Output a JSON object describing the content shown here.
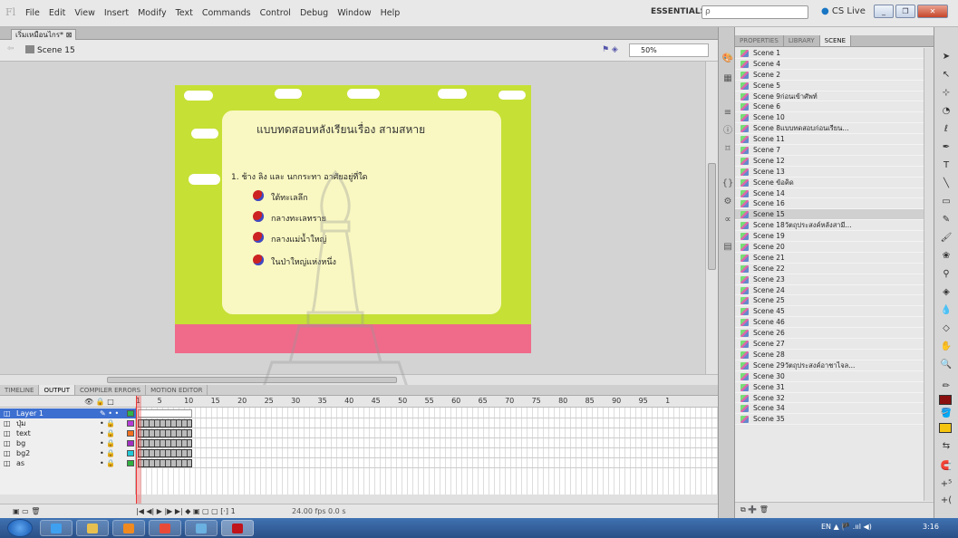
{
  "app": {
    "logo": "Fl",
    "menus": [
      "File",
      "Edit",
      "View",
      "Insert",
      "Modify",
      "Text",
      "Commands",
      "Control",
      "Debug",
      "Window",
      "Help"
    ],
    "workspace": "ESSENTIALS ▾",
    "search_placeholder": "ρ",
    "cs_live": "CS Live"
  },
  "document": {
    "tab_label": "เริ่มเหมือนไกร* ⊠",
    "scene_crumb": "Scene 15",
    "zoom": "50%"
  },
  "stage": {
    "title": "แบบทดสอบหลังเรียนเรื่อง  สามสหาย",
    "question": "1. ช้าง ลิง และ นกกระทา อาศัยอยู่ที่ใด",
    "choices": [
      "ใต้ทะเลลึก",
      "กลางทะเลทราย",
      "กลางแม่น้ำใหญ่",
      "ในป่าใหญ่แห่งหนึ่ง"
    ],
    "colors": {
      "background": "#c6e036",
      "card": "#f9f8c2",
      "footer": "#f06a8a"
    }
  },
  "timeline": {
    "tabs": [
      "TIMELINE",
      "OUTPUT",
      "COMPILER ERRORS",
      "MOTION EDITOR"
    ],
    "active_tab": "OUTPUT",
    "ruler": [
      "1",
      "5",
      "10",
      "15",
      "20",
      "25",
      "30",
      "35",
      "40",
      "45",
      "50",
      "55",
      "60",
      "65",
      "70",
      "75",
      "80",
      "85",
      "90",
      "95",
      "1"
    ],
    "layers": [
      {
        "name": "Layer 1",
        "marks": "✎  •  •",
        "color": "#2fb54b"
      },
      {
        "name": "ปุ่ม",
        "marks": "•  🔒",
        "color": "#b43cd6"
      },
      {
        "name": "text",
        "marks": "•  🔒",
        "color": "#f07020"
      },
      {
        "name": "bg",
        "marks": "•  🔒",
        "color": "#a030c0"
      },
      {
        "name": "bg2",
        "marks": "•  🔒",
        "color": "#20c8d8"
      },
      {
        "name": "as",
        "marks": "•  🔒",
        "color": "#30b040"
      }
    ],
    "controls": "|◀ ◀| ▶ |▶ ▶|  ◆ ▣ ▢ ▢ [·] 1",
    "fps": "24.00 fps  0.0 s"
  },
  "panel": {
    "tabs": [
      "PROPERTIES",
      "LIBRARY",
      "SCENE"
    ],
    "active_tab": "SCENE",
    "scenes": [
      "Scene 1",
      "Scene 4",
      "Scene 2",
      "Scene 5",
      "Scene 9ก่อนเข้าศัพท์",
      "Scene 6",
      "Scene 10",
      "Scene 8แบบทดสอบก่อนเรียน...",
      "Scene 11",
      "Scene 7",
      "Scene 12",
      "Scene 13",
      "Scene ข้อคิด",
      "Scene 14",
      "Scene 16",
      "Scene 15",
      "Scene 18วัตถุประสงค์หลังสามี...",
      "Scene 19",
      "Scene 20",
      "Scene 21",
      "Scene 22",
      "Scene 23",
      "Scene 24",
      "Scene 25",
      "Scene 45",
      "Scene 46",
      "Scene 26",
      "Scene 27",
      "Scene 28",
      "Scene 29วัตถุประสงค์อาชาไจล...",
      "Scene 30",
      "Scene 31",
      "Scene 32",
      "Scene 34",
      "Scene 35"
    ],
    "selected": "Scene 15"
  },
  "taskbar": {
    "tray": "EN  ▲  🏴  .ııl  ◀)",
    "clock": "3:16"
  }
}
